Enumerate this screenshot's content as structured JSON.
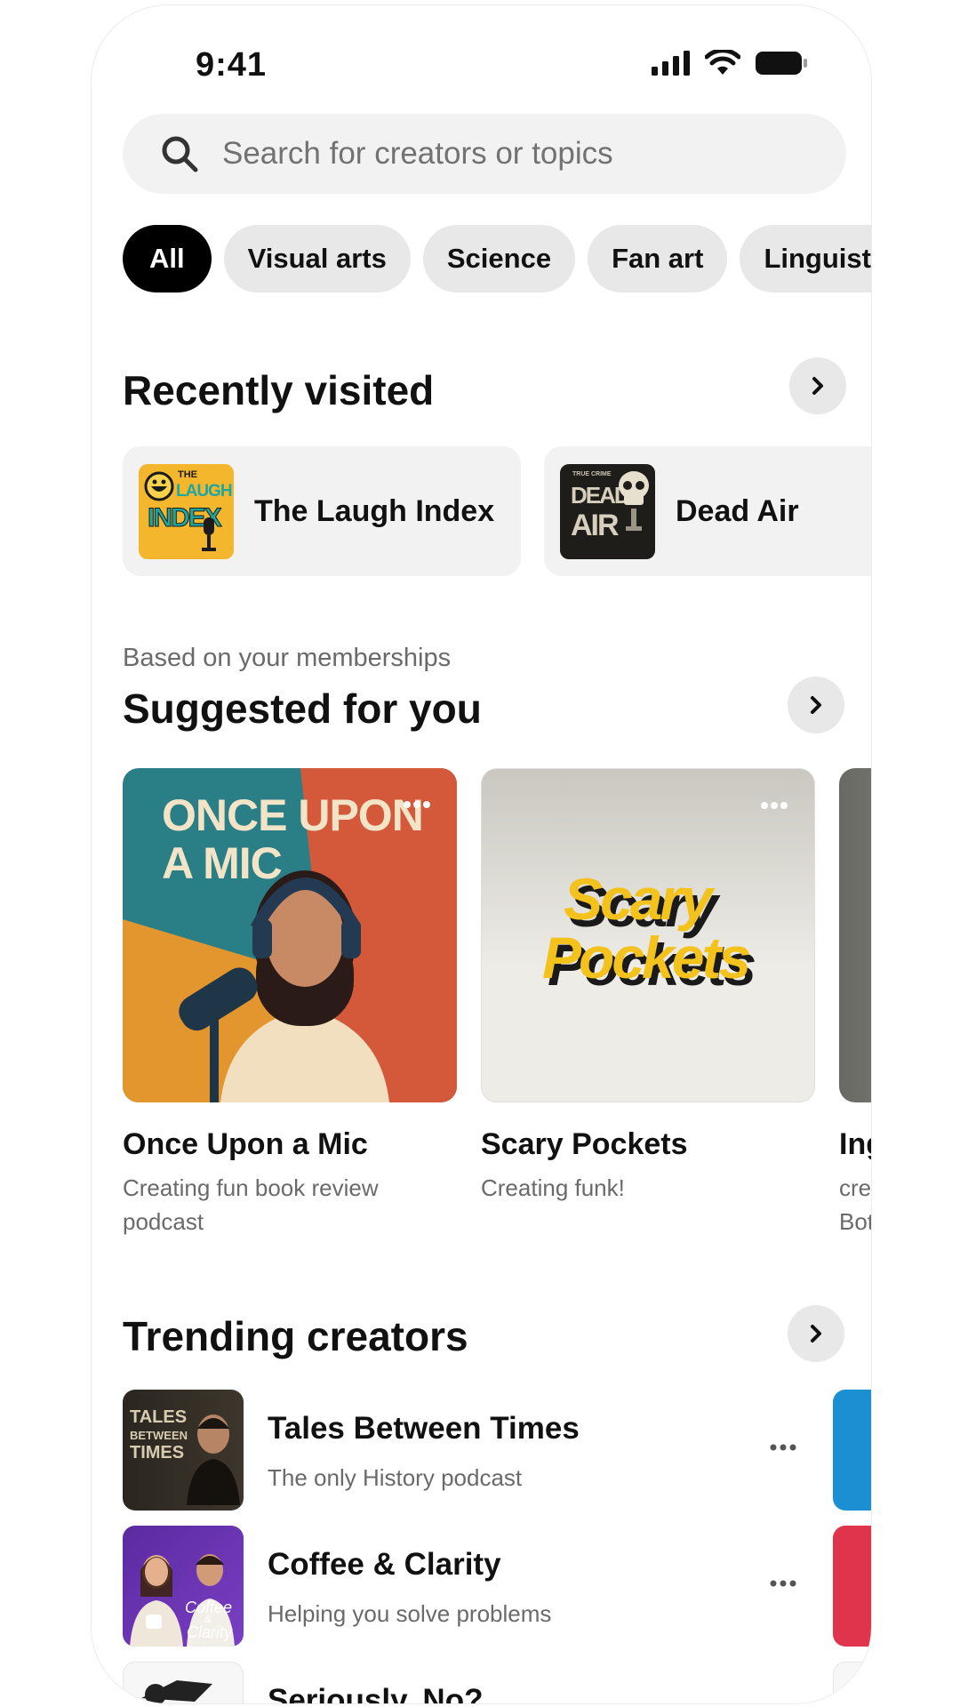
{
  "status_bar": {
    "time": "9:41"
  },
  "search": {
    "placeholder": "Search for creators or topics"
  },
  "chips": [
    "All",
    "Visual arts",
    "Science",
    "Fan art",
    "Linguistics"
  ],
  "recently_visited": {
    "title": "Recently visited",
    "items": [
      {
        "name": "The Laugh Index",
        "art_text_small": "THE",
        "art_text_1": "LAUGH",
        "art_text_2": "INDEX"
      },
      {
        "name": "Dead Air",
        "art_text_small": "TRUE CRIME",
        "art_text_1": "DEAD",
        "art_text_2": "AIR"
      }
    ]
  },
  "suggested": {
    "subtitle": "Based on your memberships",
    "title": "Suggested for you",
    "items": [
      {
        "title": "Once Upon a Mic",
        "desc": "Creating fun book review podcast",
        "art_line1": "ONCE UPON",
        "art_line2": "A MIC"
      },
      {
        "title": "Scary Pockets",
        "desc": "Creating funk!",
        "art_line1": "Scary",
        "art_line2": "Pockets"
      },
      {
        "title": "Ing",
        "desc_line1": "cre",
        "desc_line2": "Bot"
      }
    ]
  },
  "trending": {
    "title": "Trending creators",
    "items": [
      {
        "name": "Tales Between Times",
        "desc": "The only History podcast",
        "art_line1": "TALES",
        "art_line2": "BETWEEN",
        "art_line3": "TIMES"
      },
      {
        "name": "Coffee & Clarity",
        "desc": "Helping you solve problems",
        "art_line1": "Coffee",
        "art_line2": "&",
        "art_line3": "Clarity"
      },
      {
        "name": "Seriously, No?"
      }
    ]
  },
  "colors": {
    "accent": "#000000",
    "chip_bg": "#e8e8e8",
    "card_bg": "#f2f2f2",
    "muted_text": "#6a6a6a"
  }
}
